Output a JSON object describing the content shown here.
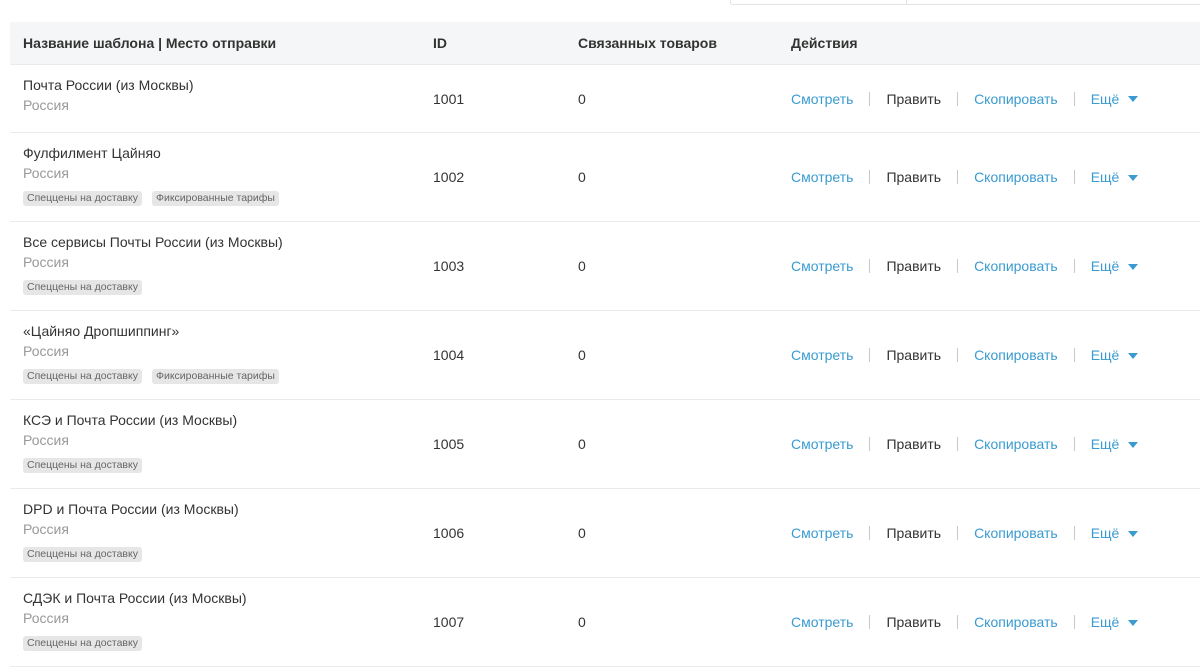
{
  "table": {
    "headers": {
      "name": "Название шаблона | Место отправки",
      "id": "ID",
      "count": "Связанных товаров",
      "actions": "Действия"
    },
    "actions": {
      "view": "Смотреть",
      "edit": "Править",
      "copy": "Скопировать",
      "more": "Ещё"
    },
    "rows": [
      {
        "name": "Почта России (из Москвы)",
        "place": "Россия",
        "tags": [],
        "id": "1001",
        "count": "0"
      },
      {
        "name": "Фулфилмент Цайняо",
        "place": "Россия",
        "tags": [
          "Спеццены на доставку",
          "Фиксированные тарифы"
        ],
        "id": "1002",
        "count": "0"
      },
      {
        "name": "Все сервисы Почты России (из Москвы)",
        "place": "Россия",
        "tags": [
          "Спеццены на доставку"
        ],
        "id": "1003",
        "count": "0"
      },
      {
        "name": "«Цайняо Дропшиппинг»",
        "place": "Россия",
        "tags": [
          "Спеццены на доставку",
          "Фиксированные тарифы"
        ],
        "id": "1004",
        "count": "0"
      },
      {
        "name": "КСЭ и Почта России (из Москвы)",
        "place": "Россия",
        "tags": [
          "Спеццены на доставку"
        ],
        "id": "1005",
        "count": "0"
      },
      {
        "name": "DPD и Почта России (из Москвы)",
        "place": "Россия",
        "tags": [
          "Спеццены на доставку"
        ],
        "id": "1006",
        "count": "0"
      },
      {
        "name": "СДЭК и Почта России (из Москвы)",
        "place": "Россия",
        "tags": [
          "Спеццены на доставку"
        ],
        "id": "1007",
        "count": "0"
      }
    ]
  },
  "colors": {
    "link": "#3a9bd1",
    "header_bg": "#f5f6f7",
    "muted_text": "#999999",
    "tag_bg": "#e6e6e6"
  },
  "icons": {
    "more_caret": "caret-down-icon"
  }
}
